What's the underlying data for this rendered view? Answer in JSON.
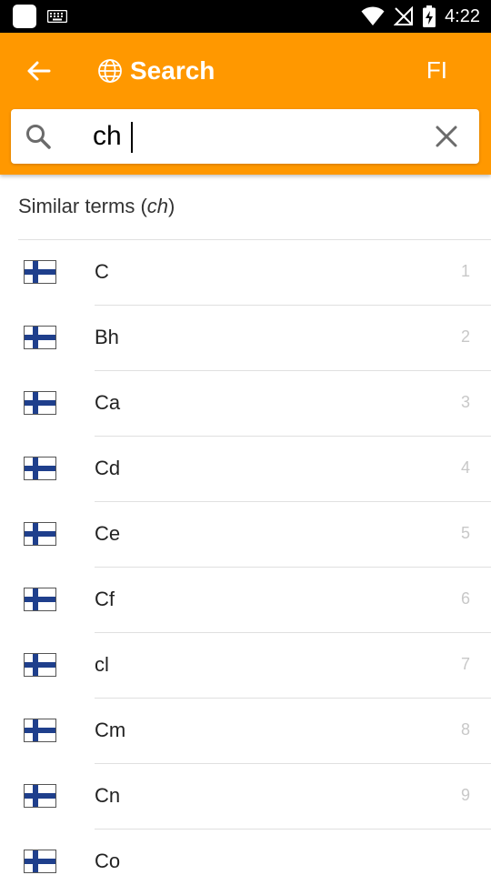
{
  "status": {
    "time": "4:22"
  },
  "appbar": {
    "title": "Search",
    "lang": "FI"
  },
  "search": {
    "value": "ch"
  },
  "section": {
    "prefix": "Similar terms (",
    "term": "ch",
    "suffix": ")"
  },
  "results": [
    {
      "term": "C",
      "rank": "1"
    },
    {
      "term": "Bh",
      "rank": "2"
    },
    {
      "term": "Ca",
      "rank": "3"
    },
    {
      "term": "Cd",
      "rank": "4"
    },
    {
      "term": "Ce",
      "rank": "5"
    },
    {
      "term": "Cf",
      "rank": "6"
    },
    {
      "term": "cl",
      "rank": "7"
    },
    {
      "term": "Cm",
      "rank": "8"
    },
    {
      "term": "Cn",
      "rank": "9"
    },
    {
      "term": "Co",
      "rank": ""
    }
  ],
  "colors": {
    "accent": "#ff9800",
    "flag_blue": "#1f3f8c"
  }
}
